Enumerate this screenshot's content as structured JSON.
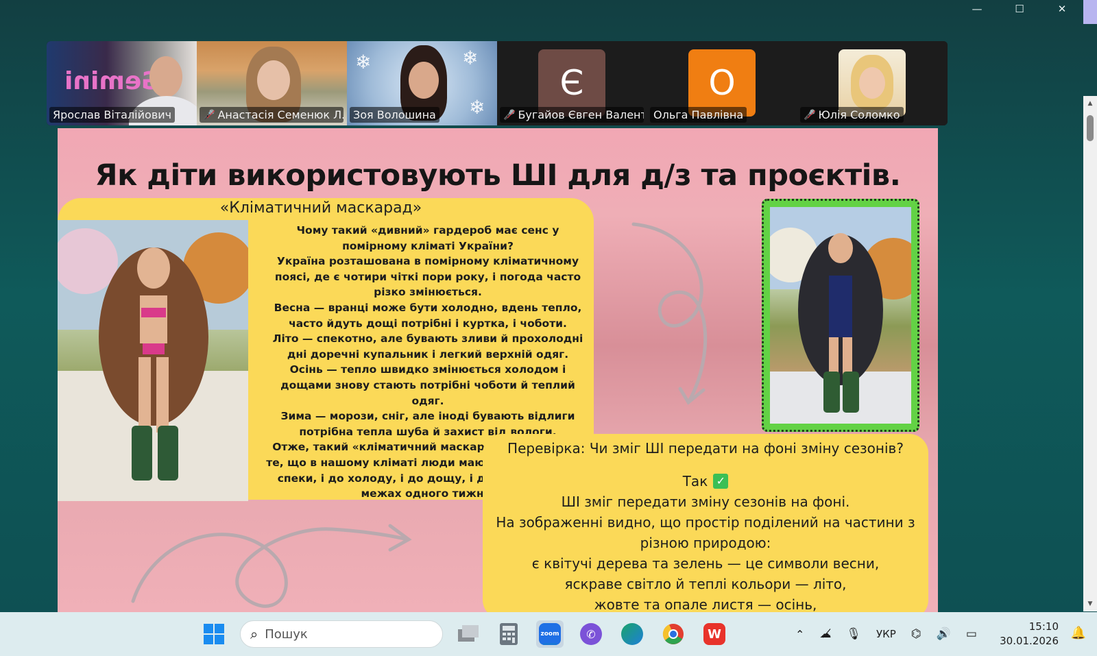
{
  "window": {
    "controls": [
      "—",
      "☐",
      "✕"
    ]
  },
  "participants": [
    {
      "name": "Ярослав Віталійович",
      "muted": false,
      "type": "video",
      "overlay_text": "Gemini"
    },
    {
      "name": "Анастасія Семенюк Л...",
      "muted": true,
      "type": "video"
    },
    {
      "name": "Зоя Волошина",
      "muted": false,
      "type": "video",
      "speaking": true
    },
    {
      "name": "Бугайов Євген Валент...",
      "muted": true,
      "type": "avatar",
      "initial": "Є",
      "color": "#6e4b45"
    },
    {
      "name": "Ольга Павлівна",
      "muted": false,
      "type": "avatar",
      "initial": "О",
      "color": "#f07e12"
    },
    {
      "name": "Юлія Соломко",
      "muted": true,
      "type": "photo"
    }
  ],
  "slide": {
    "title": "Як діти використовують ШІ для д/з та проєктів.",
    "subtitle": "«Кліматичний маскарад»",
    "body": [
      "Чому такий «дивний» гардероб має сенс у помірному кліматі України?",
      "Україна розташована в помірному кліматичному поясі, де є чотири чіткі пори року, і погода часто різко змінюється.",
      "Весна — вранці може бути холодно, вдень тепло, часто йдуть дощі  потрібні і куртка, і чоботи.",
      "Літо — спекотно, але бувають зливи й прохолодні дні  доречні купальник і легкий верхній одяг.",
      "Осінь — тепло швидко змінюється холодом і дощами  знову стають потрібні чоботи й теплий одяг.",
      "Зима — морози, сніг, але іноді бувають відлиги  потрібна тепла шуба й захист від вологи.",
      "Отже, такий «кліматичний маскарад» відображає те, що в нашому кліматі люди мають бути готові до спеки, і до холоду, і до дощу, і до снігу навіть у межах одного тижня."
    ],
    "check": {
      "question": "Перевірка: Чи зміг ШІ передати на фоні зміну сезонів?",
      "answer": "Так",
      "lines": [
        "ШІ зміг передати зміну сезонів на фоні.",
        "На зображенні видно, що простір поділений на частини з різною природою:",
        "є квітучі дерева та зелень — це символи весни,",
        "яскраве світло й теплі кольори — літо,",
        "жовте та опале листя — осінь,"
      ]
    }
  },
  "taskbar": {
    "search_placeholder": "Пошук",
    "apps": [
      "windows-start",
      "task-view",
      "calculator",
      "zoom",
      "viber",
      "edge",
      "chrome",
      "wps-office"
    ],
    "zoom_label": "zoom",
    "language": "УКР",
    "time": "15:10",
    "date": "30.01.2026"
  },
  "colors": {
    "slide_yellow": "#fbd958",
    "slide_pink": "#efaeb6",
    "speaking_border": "#23d16b",
    "mute_red": "#e0343c",
    "photo_frame_green": "#63d245"
  }
}
